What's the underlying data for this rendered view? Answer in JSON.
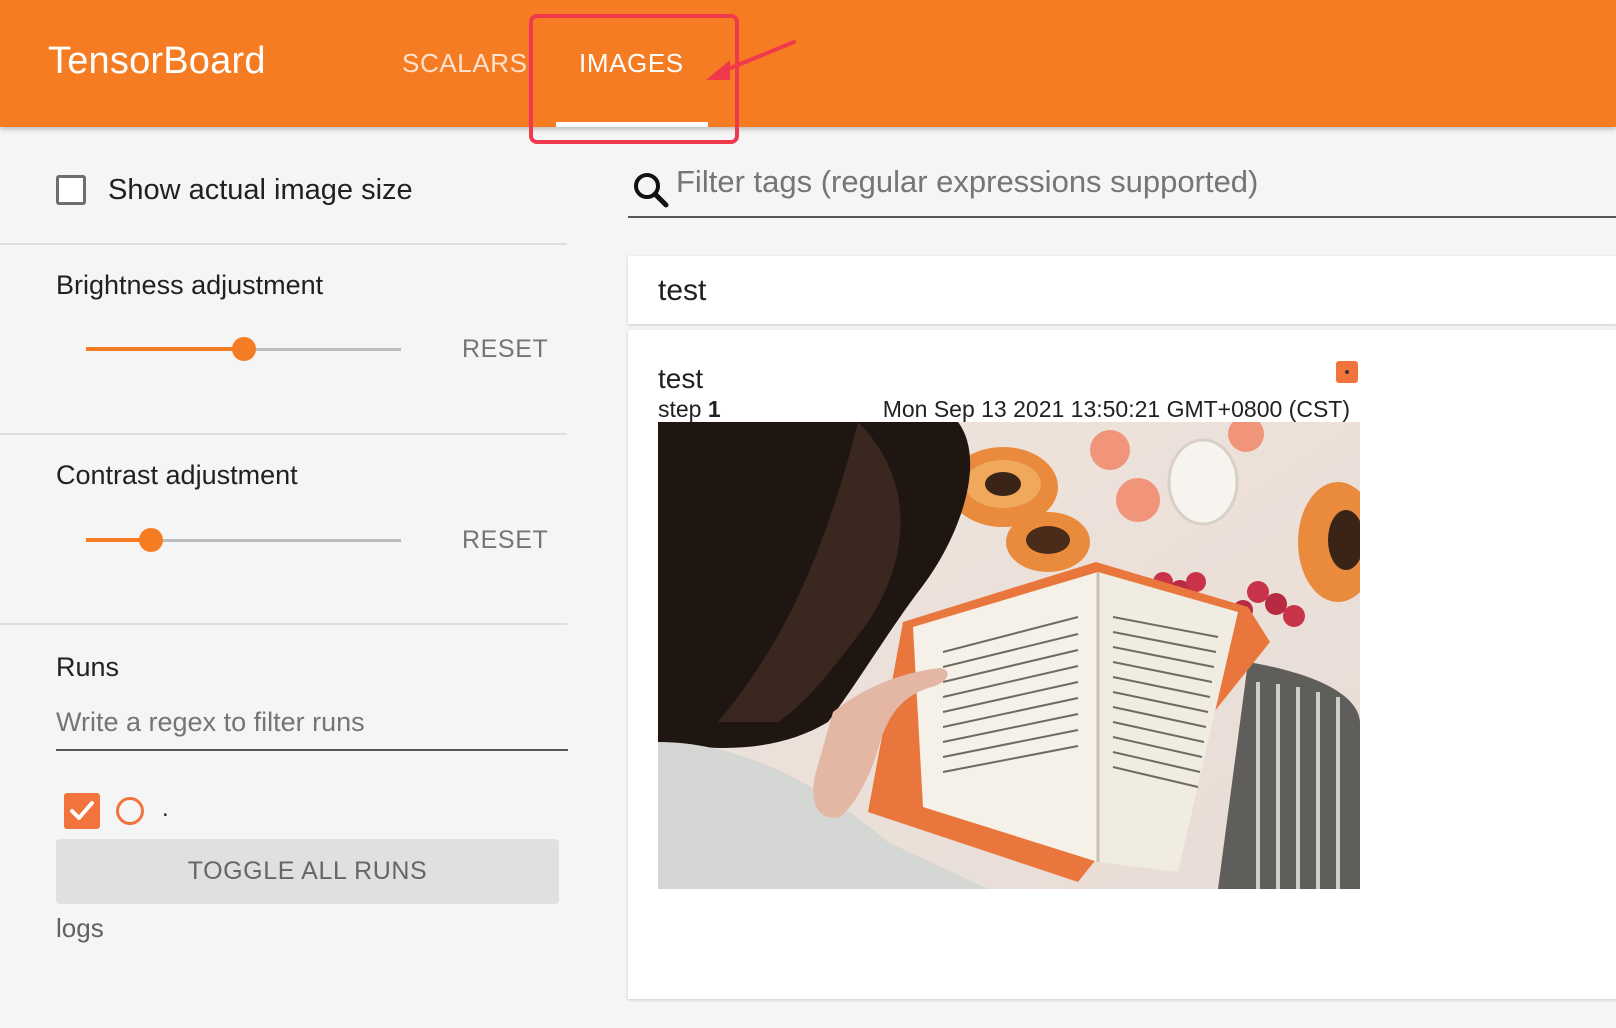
{
  "header": {
    "brand": "TensorBoard",
    "tabs": [
      {
        "label": "SCALARS",
        "active": false
      },
      {
        "label": "IMAGES",
        "active": true
      }
    ],
    "accent_color": "#f57c22",
    "annotation_color": "#f0394c"
  },
  "sidebar": {
    "show_actual_size_label": "Show actual image size",
    "show_actual_size_checked": false,
    "brightness": {
      "label": "Brightness adjustment",
      "reset_label": "RESET",
      "value_fraction": 0.5
    },
    "contrast": {
      "label": "Contrast adjustment",
      "reset_label": "RESET",
      "value_fraction": 0.2
    },
    "runs": {
      "title": "Runs",
      "filter_placeholder": "Write a regex to filter runs",
      "items": [
        {
          "label": ".",
          "checked": true,
          "color": "#f2733b"
        }
      ],
      "toggle_all_label": "TOGGLE ALL RUNS",
      "logdir": "logs"
    }
  },
  "main": {
    "filter_placeholder": "Filter tags (regular expressions supported)",
    "category": {
      "title": "test"
    },
    "card": {
      "tag": "test",
      "step_label": "step",
      "step_value": "1",
      "timestamp": "Mon Sep 13 2021 13:50:21 GMT+0800 (CST)"
    }
  }
}
